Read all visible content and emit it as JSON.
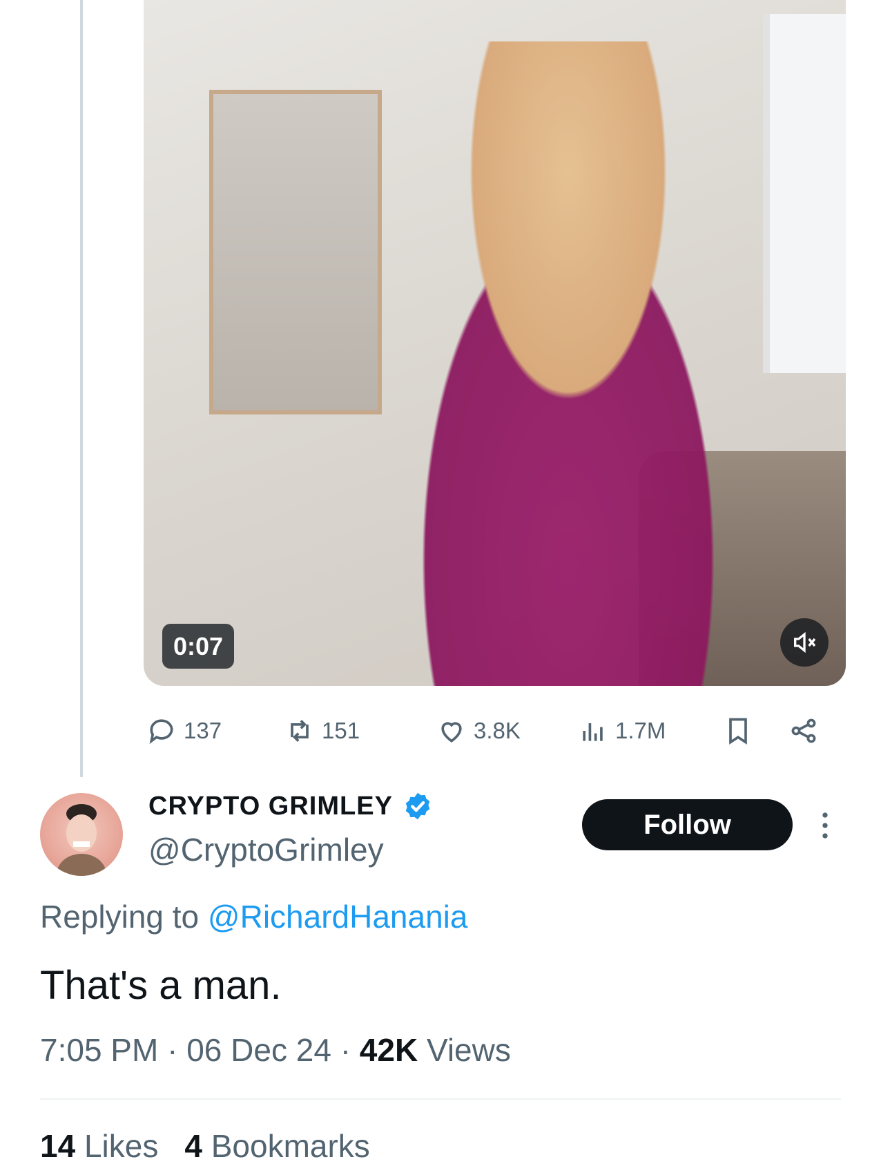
{
  "parent_tweet": {
    "video": {
      "duration": "0:07",
      "mute_icon": "speaker-muted-icon"
    },
    "actions": {
      "replies": "137",
      "reposts": "151",
      "likes": "3.8K",
      "views": "1.7M",
      "bookmark_icon": "bookmark-icon",
      "share_icon": "share-icon"
    }
  },
  "reply_tweet": {
    "author": {
      "display_name": "CRYPTO GRIMLEY",
      "handle": "@CryptoGrimley",
      "verified_icon": "verified-badge-icon"
    },
    "follow_label": "Follow",
    "replying_prefix": "Replying to",
    "replying_to": "@RichardHanania",
    "text": "That's a man.",
    "time": "7:05 PM",
    "date": "06 Dec 24",
    "views_count": "42K",
    "views_label": "Views",
    "likes_count": "14",
    "likes_label": "Likes",
    "bookmarks_count": "4",
    "bookmarks_label": "Bookmarks"
  },
  "colors": {
    "accent": "#1d9bf0",
    "secondary_text": "#536471",
    "primary_text": "#0f1419",
    "thread_line": "#cfd9de"
  }
}
